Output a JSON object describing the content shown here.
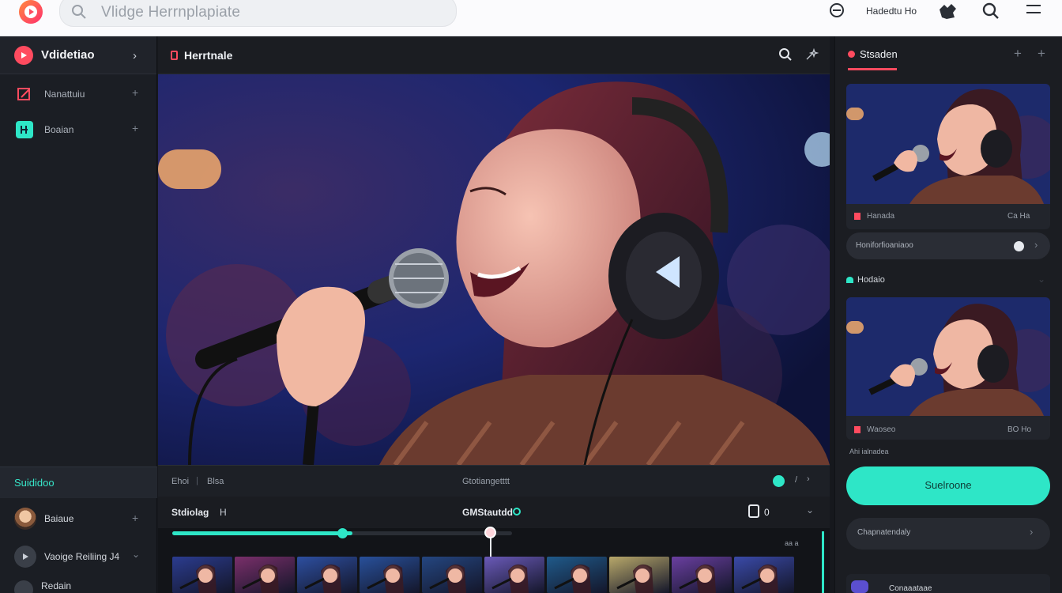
{
  "topbar": {
    "search_placeholder": "Vlidge Herrnplapiate",
    "right_label": "Hadedtu Ho",
    "icons": [
      "logo-icon",
      "search-icon",
      "e-icon",
      "puzzle-icon",
      "magnify-icon",
      "menu-icon"
    ]
  },
  "sidebar": {
    "brand": "Vdidetiao",
    "items": [
      {
        "label": "Nanattuiu",
        "icon": "edit-icon",
        "color": "#ff4b5f"
      },
      {
        "label": "Boaian",
        "icon": "teal-app-icon",
        "color": "#2ee6c7"
      }
    ],
    "section_title": "Suididoo",
    "users": [
      {
        "label": "Baiaue"
      },
      {
        "label": "Vaoige Reiliing J4"
      },
      {
        "label": "Redain"
      }
    ]
  },
  "editor": {
    "title": "Herrtnale",
    "ctrl_left_a": "Ehoi",
    "ctrl_left_b": "Blsa",
    "ctrl_center": "Gtotiangetttt",
    "track_left": "Stdiolag",
    "track_left_sub": "H",
    "track_center": "GMStautdd",
    "track_right_num": "0",
    "timeline_time": "aa a",
    "progress_a": 0.25,
    "progress_b": 0.53
  },
  "right_panel": {
    "title": "Stsaden",
    "card1_meta": "Hanada",
    "card1_meta_right": "Ca Ha",
    "dropdown_label": "Honiforfioaniaoo",
    "section2": "Hodaio",
    "card2_meta": "Waoseo",
    "card2_meta_right": "BO Ho",
    "caption": "Ahi ialnadea",
    "primary_button": "Suelroone",
    "secondary_pill": "Chapnatendaly",
    "bottom_item": "Conaaataae"
  },
  "colors": {
    "accent_teal": "#2ee6c7",
    "accent_red": "#ff4b5f",
    "panel": "#1b1d22"
  }
}
